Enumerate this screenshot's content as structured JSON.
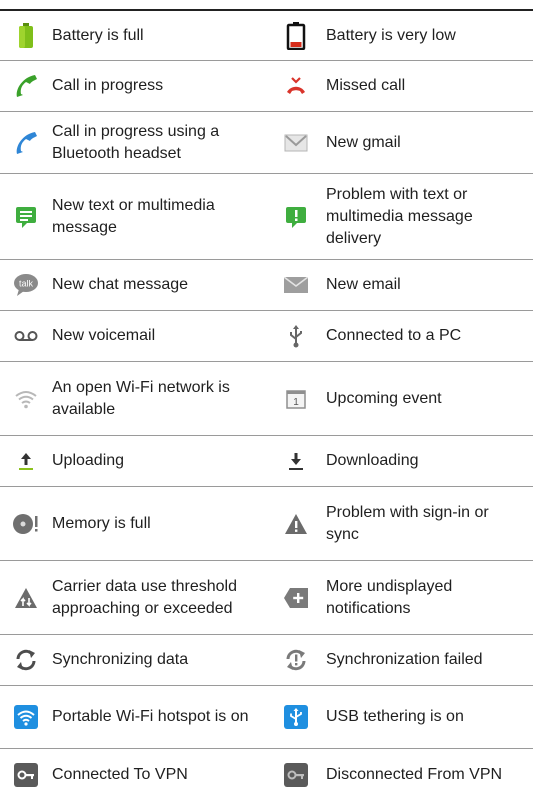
{
  "rows": [
    {
      "left": {
        "icon": "battery-full-icon",
        "label": "Battery is full"
      },
      "right": {
        "icon": "battery-low-icon",
        "label": "Battery is very low"
      }
    },
    {
      "left": {
        "icon": "call-in-progress-icon",
        "label": "Call in progress"
      },
      "right": {
        "icon": "missed-call-icon",
        "label": "Missed call"
      }
    },
    {
      "left": {
        "icon": "bluetooth-call-icon",
        "label": "Call in progress using a Bluetooth headset"
      },
      "right": {
        "icon": "gmail-icon",
        "label": "New gmail"
      }
    },
    {
      "left": {
        "icon": "sms-icon",
        "label": "New text or multimedia message"
      },
      "right": {
        "icon": "sms-error-icon",
        "label": "Problem with text or multimedia message delivery"
      }
    },
    {
      "left": {
        "icon": "talk-icon",
        "label": "New chat message"
      },
      "right": {
        "icon": "email-icon",
        "label": "New email"
      }
    },
    {
      "left": {
        "icon": "voicemail-icon",
        "label": "New voicemail"
      },
      "right": {
        "icon": "usb-icon",
        "label": "Connected to a PC"
      }
    },
    {
      "left": {
        "icon": "wifi-open-icon",
        "label": "An open Wi-Fi network is available"
      },
      "right": {
        "icon": "calendar-icon",
        "label": "Upcoming event"
      }
    },
    {
      "left": {
        "icon": "upload-icon",
        "label": "Uploading"
      },
      "right": {
        "icon": "download-icon",
        "label": "Downloading"
      }
    },
    {
      "left": {
        "icon": "memory-full-icon",
        "label": "Memory is full"
      },
      "right": {
        "icon": "warning-icon",
        "label": "Problem with sign-in or sync"
      }
    },
    {
      "left": {
        "icon": "data-threshold-icon",
        "label": "Carrier data use threshold approaching or exceeded"
      },
      "right": {
        "icon": "more-notifications-icon",
        "label": "More undisplayed notifications"
      }
    },
    {
      "left": {
        "icon": "sync-icon",
        "label": "Synchronizing data"
      },
      "right": {
        "icon": "sync-failed-icon",
        "label": "Synchronization failed"
      }
    },
    {
      "left": {
        "icon": "wifi-hotspot-icon",
        "label": "Portable Wi-Fi hotspot is on"
      },
      "right": {
        "icon": "usb-tethering-icon",
        "label": "USB tethering is on"
      }
    },
    {
      "left": {
        "icon": "vpn-connected-icon",
        "label": "Connected To VPN"
      },
      "right": {
        "icon": "vpn-disconnected-icon",
        "label": "Disconnected From VPN"
      }
    }
  ]
}
